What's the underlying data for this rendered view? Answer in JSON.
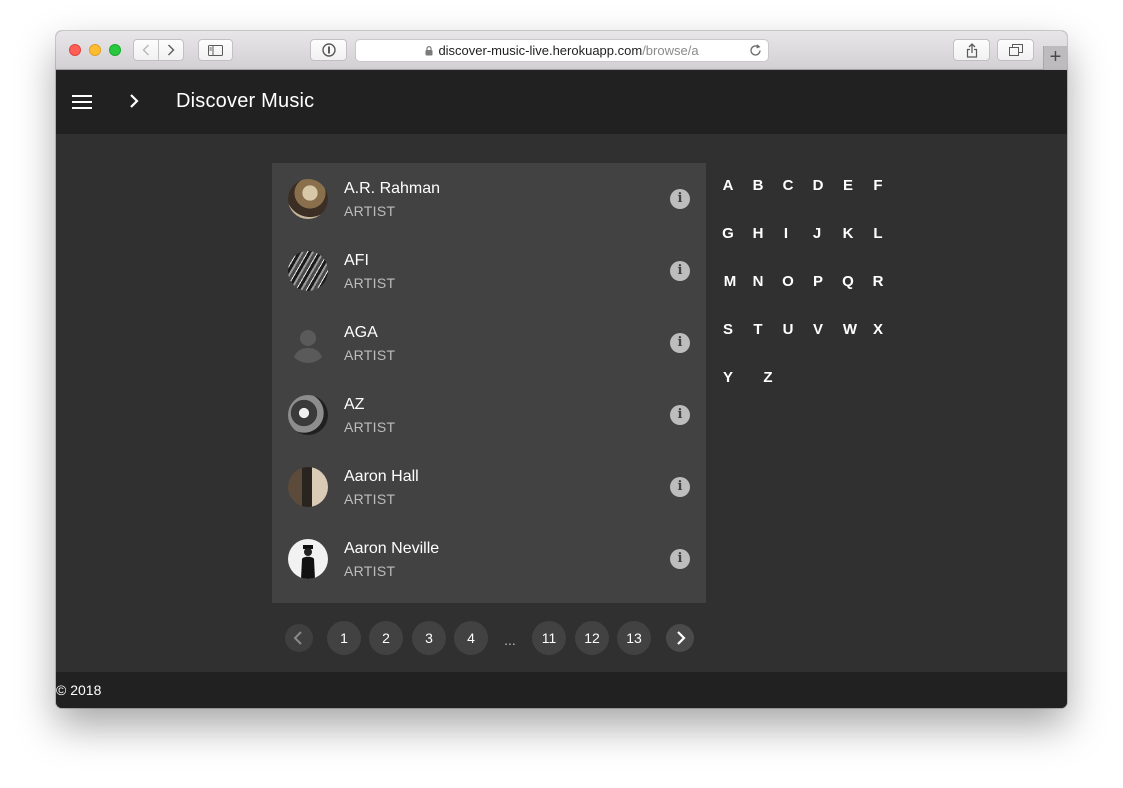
{
  "browser": {
    "url_host": "discover-music-live.herokuapp.com",
    "url_path": "/browse/a",
    "new_tab_label": "+"
  },
  "app": {
    "title": "Discover Music"
  },
  "artists": [
    {
      "name": "A.R. Rahman",
      "type": "ARTIST",
      "avatar": "photo-sepia"
    },
    {
      "name": "AFI",
      "type": "ARTIST",
      "avatar": "photo-bw"
    },
    {
      "name": "AGA",
      "type": "ARTIST",
      "avatar": "placeholder-person-icon"
    },
    {
      "name": "AZ",
      "type": "ARTIST",
      "avatar": "photo-bw"
    },
    {
      "name": "Aaron Hall",
      "type": "ARTIST",
      "avatar": "photo-sepia"
    },
    {
      "name": "Aaron Neville",
      "type": "ARTIST",
      "avatar": "photo-white"
    }
  ],
  "alphabet": [
    "A",
    "B",
    "C",
    "D",
    "E",
    "F",
    "G",
    "H",
    "I",
    "J",
    "K",
    "L",
    "M",
    "N",
    "O",
    "P",
    "Q",
    "R",
    "S",
    "T",
    "U",
    "V",
    "W",
    "X",
    "Y",
    "Z"
  ],
  "pagination": {
    "pages": [
      "1",
      "2",
      "3",
      "4",
      "11",
      "12",
      "13"
    ],
    "ellipsis": "..."
  },
  "footer": {
    "text": "© 2018"
  },
  "colors": {
    "appbar": "#212121",
    "background": "#303030",
    "card": "#424242",
    "secondary_text": "#bdbdbd"
  }
}
